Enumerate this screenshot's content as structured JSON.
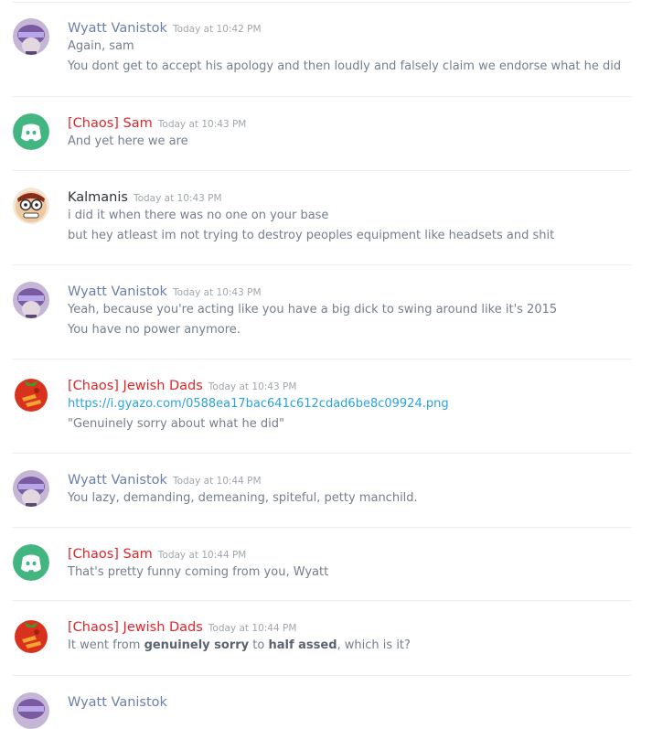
{
  "colors": {
    "wyatt": "#6c7fa8",
    "chaos": "#e0252a",
    "kalmanis": "#2f3338",
    "timestamp": "#a0a6ab",
    "text": "#737f8d",
    "link": "#2aa3dc",
    "discord_green": "#43b581"
  },
  "messages": [
    {
      "author": "Wyatt Vanistok",
      "time": "Today at 10:42 PM",
      "avatar": "wyatt-avatar-icon",
      "lines": [
        "Again, sam",
        "You dont get to accept his apology and then loudly and falsely claim we endorse what he did"
      ]
    },
    {
      "author": "[Chaos] Sam",
      "time": "Today at 10:43 PM",
      "avatar": "discord-logo-icon",
      "lines": [
        "And yet here we are"
      ]
    },
    {
      "author": "Kalmanis",
      "time": "Today at 10:43 PM",
      "avatar": "kalmanis-avatar-icon",
      "lines": [
        "i did it when there was no one on your base",
        "but hey atleast im not trying to destroy peoples equipment like headsets and shit"
      ]
    },
    {
      "author": "Wyatt Vanistok",
      "time": "Today at 10:43 PM",
      "avatar": "wyatt-avatar-icon",
      "lines": [
        "Yeah, because you're acting like you have a big dick to swing around like it's 2015",
        "You have no power anymore."
      ]
    },
    {
      "author": "[Chaos] Jewish Dads",
      "time": "Today at 10:43 PM",
      "avatar": "jewish-dads-avatar-icon",
      "link": "https://i.gyazo.com/0588ea17bac641c612cdad6be8c09924.png",
      "lines": [
        "\"Genuinely sorry about what he did\""
      ]
    },
    {
      "author": "Wyatt Vanistok",
      "time": "Today at 10:44 PM",
      "avatar": "wyatt-avatar-icon",
      "lines": [
        "You lazy, demanding, demeaning, spiteful, petty manchild."
      ]
    },
    {
      "author": "[Chaos] Sam",
      "time": "Today at 10:44 PM",
      "avatar": "discord-logo-icon",
      "lines": [
        "That's pretty funny coming from you, Wyatt"
      ]
    },
    {
      "author": "[Chaos] Jewish Dads",
      "time": "Today at 10:44 PM",
      "avatar": "jewish-dads-avatar-icon",
      "rich": {
        "a": "It went from ",
        "b1": "genuinely sorry",
        "c": " to ",
        "b2": "half assed",
        "d": ", which is it?"
      }
    },
    {
      "author": "Wyatt Vanistok",
      "time": "",
      "avatar": "wyatt-avatar-icon",
      "lines": []
    }
  ]
}
